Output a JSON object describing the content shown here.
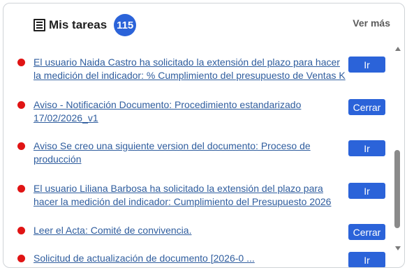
{
  "header": {
    "title": "Mis tareas",
    "count": "115",
    "see_more": "Ver más",
    "icon": "list-icon"
  },
  "tasks": [
    {
      "line1": "El usuario Naida Castro ha solicitado la extensión del plazo para hacer",
      "line2": "la medición del indicador: % Cumplimiento del presupuesto de Ventas K",
      "action": "Ir"
    },
    {
      "line1": "Aviso - Notificación Documento: Procedimiento estandarizado",
      "line2": "17/02/2026_v1",
      "action": "Cerrar"
    },
    {
      "line1": "Aviso Se creo una siguiente version del documento: Proceso de",
      "line2": "producción",
      "action": "Ir"
    },
    {
      "line1": "El usuario Liliana Barbosa ha solicitado la extensión del plazo para",
      "line2": "hacer la medición del indicador: Cumplimiento del Presupuesto 2026",
      "action": "Ir"
    },
    {
      "line1": "Leer el Acta: Comité de convivencia.",
      "line2": "",
      "action": "Cerrar"
    },
    {
      "line1": "Solicitud de actualización de documento [2026-0 ...",
      "line2": "",
      "action": "Ir"
    }
  ],
  "colors": {
    "accent": "#2b63d9",
    "status_dot": "#e01414",
    "link": "#2f5d9e"
  }
}
